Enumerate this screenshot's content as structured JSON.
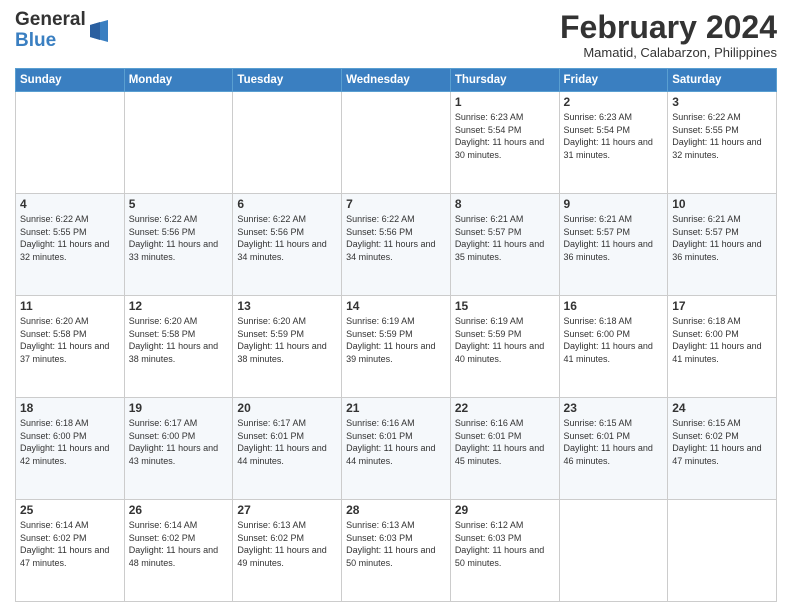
{
  "logo": {
    "general": "General",
    "blue": "Blue"
  },
  "title": {
    "month": "February 2024",
    "location": "Mamatid, Calabarzon, Philippines"
  },
  "weekdays": [
    "Sunday",
    "Monday",
    "Tuesday",
    "Wednesday",
    "Thursday",
    "Friday",
    "Saturday"
  ],
  "weeks": [
    [
      {
        "day": "",
        "info": ""
      },
      {
        "day": "",
        "info": ""
      },
      {
        "day": "",
        "info": ""
      },
      {
        "day": "",
        "info": ""
      },
      {
        "day": "1",
        "info": "Sunrise: 6:23 AM\nSunset: 5:54 PM\nDaylight: 11 hours and 30 minutes."
      },
      {
        "day": "2",
        "info": "Sunrise: 6:23 AM\nSunset: 5:54 PM\nDaylight: 11 hours and 31 minutes."
      },
      {
        "day": "3",
        "info": "Sunrise: 6:22 AM\nSunset: 5:55 PM\nDaylight: 11 hours and 32 minutes."
      }
    ],
    [
      {
        "day": "4",
        "info": "Sunrise: 6:22 AM\nSunset: 5:55 PM\nDaylight: 11 hours and 32 minutes."
      },
      {
        "day": "5",
        "info": "Sunrise: 6:22 AM\nSunset: 5:56 PM\nDaylight: 11 hours and 33 minutes."
      },
      {
        "day": "6",
        "info": "Sunrise: 6:22 AM\nSunset: 5:56 PM\nDaylight: 11 hours and 34 minutes."
      },
      {
        "day": "7",
        "info": "Sunrise: 6:22 AM\nSunset: 5:56 PM\nDaylight: 11 hours and 34 minutes."
      },
      {
        "day": "8",
        "info": "Sunrise: 6:21 AM\nSunset: 5:57 PM\nDaylight: 11 hours and 35 minutes."
      },
      {
        "day": "9",
        "info": "Sunrise: 6:21 AM\nSunset: 5:57 PM\nDaylight: 11 hours and 36 minutes."
      },
      {
        "day": "10",
        "info": "Sunrise: 6:21 AM\nSunset: 5:57 PM\nDaylight: 11 hours and 36 minutes."
      }
    ],
    [
      {
        "day": "11",
        "info": "Sunrise: 6:20 AM\nSunset: 5:58 PM\nDaylight: 11 hours and 37 minutes."
      },
      {
        "day": "12",
        "info": "Sunrise: 6:20 AM\nSunset: 5:58 PM\nDaylight: 11 hours and 38 minutes."
      },
      {
        "day": "13",
        "info": "Sunrise: 6:20 AM\nSunset: 5:59 PM\nDaylight: 11 hours and 38 minutes."
      },
      {
        "day": "14",
        "info": "Sunrise: 6:19 AM\nSunset: 5:59 PM\nDaylight: 11 hours and 39 minutes."
      },
      {
        "day": "15",
        "info": "Sunrise: 6:19 AM\nSunset: 5:59 PM\nDaylight: 11 hours and 40 minutes."
      },
      {
        "day": "16",
        "info": "Sunrise: 6:18 AM\nSunset: 6:00 PM\nDaylight: 11 hours and 41 minutes."
      },
      {
        "day": "17",
        "info": "Sunrise: 6:18 AM\nSunset: 6:00 PM\nDaylight: 11 hours and 41 minutes."
      }
    ],
    [
      {
        "day": "18",
        "info": "Sunrise: 6:18 AM\nSunset: 6:00 PM\nDaylight: 11 hours and 42 minutes."
      },
      {
        "day": "19",
        "info": "Sunrise: 6:17 AM\nSunset: 6:00 PM\nDaylight: 11 hours and 43 minutes."
      },
      {
        "day": "20",
        "info": "Sunrise: 6:17 AM\nSunset: 6:01 PM\nDaylight: 11 hours and 44 minutes."
      },
      {
        "day": "21",
        "info": "Sunrise: 6:16 AM\nSunset: 6:01 PM\nDaylight: 11 hours and 44 minutes."
      },
      {
        "day": "22",
        "info": "Sunrise: 6:16 AM\nSunset: 6:01 PM\nDaylight: 11 hours and 45 minutes."
      },
      {
        "day": "23",
        "info": "Sunrise: 6:15 AM\nSunset: 6:01 PM\nDaylight: 11 hours and 46 minutes."
      },
      {
        "day": "24",
        "info": "Sunrise: 6:15 AM\nSunset: 6:02 PM\nDaylight: 11 hours and 47 minutes."
      }
    ],
    [
      {
        "day": "25",
        "info": "Sunrise: 6:14 AM\nSunset: 6:02 PM\nDaylight: 11 hours and 47 minutes."
      },
      {
        "day": "26",
        "info": "Sunrise: 6:14 AM\nSunset: 6:02 PM\nDaylight: 11 hours and 48 minutes."
      },
      {
        "day": "27",
        "info": "Sunrise: 6:13 AM\nSunset: 6:02 PM\nDaylight: 11 hours and 49 minutes."
      },
      {
        "day": "28",
        "info": "Sunrise: 6:13 AM\nSunset: 6:03 PM\nDaylight: 11 hours and 50 minutes."
      },
      {
        "day": "29",
        "info": "Sunrise: 6:12 AM\nSunset: 6:03 PM\nDaylight: 11 hours and 50 minutes."
      },
      {
        "day": "",
        "info": ""
      },
      {
        "day": "",
        "info": ""
      }
    ]
  ]
}
